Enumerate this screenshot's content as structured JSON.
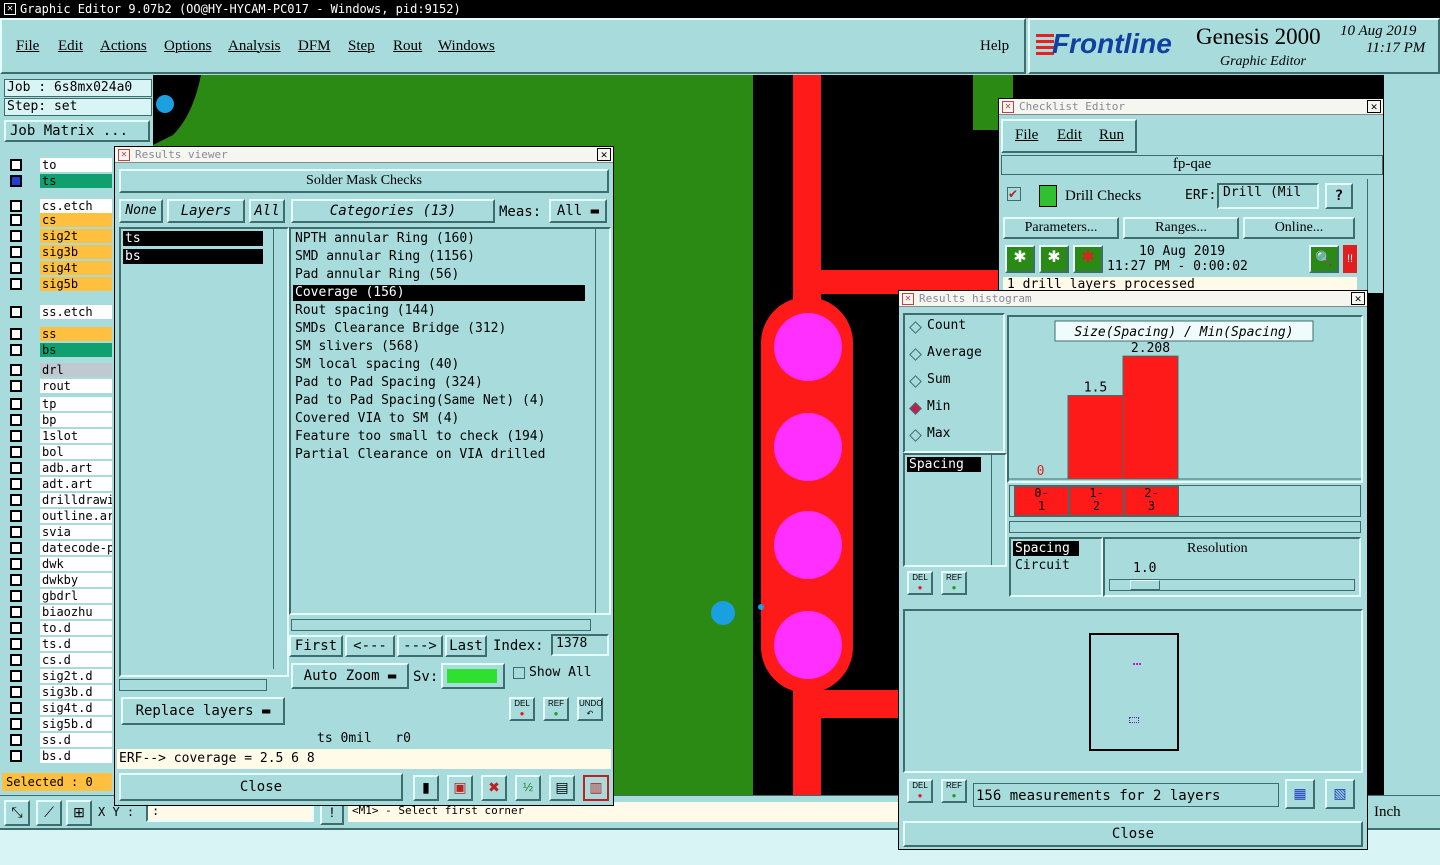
{
  "app": {
    "title": "Graphic Editor 9.07b2 (OO@HY-HYCAM-PC017 - Windows, pid:9152)"
  },
  "menu": {
    "items": [
      "File",
      "Edit",
      "Actions",
      "Options",
      "Analysis",
      "DFM",
      "Step",
      "Rout",
      "Windows"
    ],
    "help": "Help"
  },
  "brand": {
    "logo": "Frontline",
    "product": "Genesis 2000",
    "subtitle": "Graphic Editor",
    "date": "10 Aug 2019",
    "time": "11:17 PM"
  },
  "job": {
    "job_label": "Job : 6s8mx024a0",
    "step_label": "Step: set",
    "matrix_button": "Job Matrix ..."
  },
  "layers": [
    {
      "name": "to",
      "bg": "#ffffff"
    },
    {
      "name": "ts",
      "bg": "#10a070"
    },
    {
      "name": "cs.etch",
      "bg": "#ffffff"
    },
    {
      "name": "cs",
      "bg": "#ffc040"
    },
    {
      "name": "sig2t",
      "bg": "#ffc040"
    },
    {
      "name": "sig3b",
      "bg": "#ffc040"
    },
    {
      "name": "sig4t",
      "bg": "#ffc040"
    },
    {
      "name": "sig5b",
      "bg": "#ffc040"
    },
    {
      "name": "ss.etch",
      "bg": "#ffffff"
    },
    {
      "name": "ss",
      "bg": "#ffc040"
    },
    {
      "name": "bs",
      "bg": "#10a070"
    },
    {
      "name": "drl",
      "bg": "#c0c8d0"
    },
    {
      "name": "rout",
      "bg": "#ffffff"
    },
    {
      "name": "tp",
      "bg": "#ffffff"
    },
    {
      "name": "bp",
      "bg": "#ffffff"
    },
    {
      "name": "1slot",
      "bg": "#ffffff"
    },
    {
      "name": "bol",
      "bg": "#ffffff"
    },
    {
      "name": "adb.art",
      "bg": "#ffffff"
    },
    {
      "name": "adt.art",
      "bg": "#ffffff"
    },
    {
      "name": "drilldrawi",
      "bg": "#ffffff"
    },
    {
      "name": "outline.ar",
      "bg": "#ffffff"
    },
    {
      "name": "svia",
      "bg": "#ffffff"
    },
    {
      "name": "datecode-p",
      "bg": "#ffffff"
    },
    {
      "name": "dwk",
      "bg": "#ffffff"
    },
    {
      "name": "dwkby",
      "bg": "#ffffff"
    },
    {
      "name": "gbdrl",
      "bg": "#ffffff"
    },
    {
      "name": "biaozhu",
      "bg": "#ffffff"
    },
    {
      "name": "to.d",
      "bg": "#ffffff"
    },
    {
      "name": "ts.d",
      "bg": "#ffffff"
    },
    {
      "name": "cs.d",
      "bg": "#ffffff"
    },
    {
      "name": "sig2t.d",
      "bg": "#ffffff"
    },
    {
      "name": "sig3b.d",
      "bg": "#ffffff"
    },
    {
      "name": "sig4t.d",
      "bg": "#ffffff"
    },
    {
      "name": "sig5b.d",
      "bg": "#ffffff"
    },
    {
      "name": "ss.d",
      "bg": "#ffffff"
    },
    {
      "name": "bs.d",
      "bg": "#ffffff"
    }
  ],
  "selected": "Selected : 0",
  "status": {
    "xy_label": "X Y :",
    "xy_value": ":",
    "prompt": "<M1> - Select first corner",
    "units": "Inch"
  },
  "results": {
    "title": "Results viewer",
    "header": "Solder Mask Checks",
    "none": "None",
    "layers": "Layers",
    "all": "All",
    "categories": "Categories (13)",
    "meas_label": "Meas:",
    "meas_value": "All",
    "layer_list": [
      "ts",
      "bs"
    ],
    "category_list": [
      "NPTH annular Ring (160)",
      "SMD annular Ring (1156)",
      "Pad annular Ring (56)",
      "Coverage (156)",
      "Rout spacing (144)",
      "SMDs Clearance Bridge (312)",
      "SM slivers (568)",
      "SM local spacing (40)",
      "Pad to Pad Spacing (324)",
      "Pad to Pad Spacing(Same Net) (4)",
      "Covered VIA to SM (4)",
      "Feature too small to check (194)",
      "Partial Clearance on VIA drilled"
    ],
    "selected_category": "Coverage (156)",
    "first": "First",
    "prev": "<---",
    "next": "--->",
    "last": "Last",
    "index_label": "Index:",
    "index_value": "1378",
    "autozoom": "Auto Zoom",
    "sv_label": "Sv:",
    "showall": "Show All",
    "replace": "Replace layers",
    "info": "ts 0mil   r0",
    "erf": "ERF--> coverage = 2.5 6 8",
    "close": "Close",
    "del": "DEL",
    "ref": "REF",
    "undo": "UNDO"
  },
  "checklist": {
    "title": "Checklist Editor",
    "menu": [
      "File",
      "Edit",
      "Run"
    ],
    "name": "fp-qae",
    "check": "Drill Checks",
    "erf_label": "ERF:",
    "erf_value": "Drill (Mil",
    "help": "?",
    "params": "Parameters...",
    "ranges": "Ranges...",
    "online": "Online...",
    "date": "10 Aug 2019",
    "time": "11:27 PM - 0:00:02",
    "status": "1 drill layers processed"
  },
  "histogram": {
    "title": "Results histogram",
    "modes": [
      "Count",
      "Average",
      "Sum",
      "Min",
      "Max"
    ],
    "selected_mode": "Min",
    "measure_list": [
      "Spacing"
    ],
    "chart_title": "Size(Spacing) / Min(Spacing)",
    "bins": [
      {
        "low": "0-",
        "high": "1"
      },
      {
        "low": "1-",
        "high": "2"
      },
      {
        "low": "2-",
        "high": "3"
      }
    ],
    "types": [
      "Spacing",
      "Circuit"
    ],
    "resolution_label": "Resolution",
    "resolution_value": "1.0",
    "summary": "156 measurements for 2 layers",
    "close": "Close",
    "del": "DEL",
    "ref": "REF"
  },
  "chart_data": {
    "type": "bar",
    "title": "Size(Spacing) / Min(Spacing)",
    "categories": [
      "0-1",
      "1-2",
      "2-3"
    ],
    "values": [
      0,
      1.5,
      2.208
    ],
    "ylim": [
      0,
      2.3
    ]
  },
  "colors": {
    "board_green": "#2a8a14",
    "pad_red": "#ff1a1a",
    "pad_magenta": "#ff30ff",
    "via_blue": "#1aa0e0",
    "panel": "#a8dcdc"
  }
}
